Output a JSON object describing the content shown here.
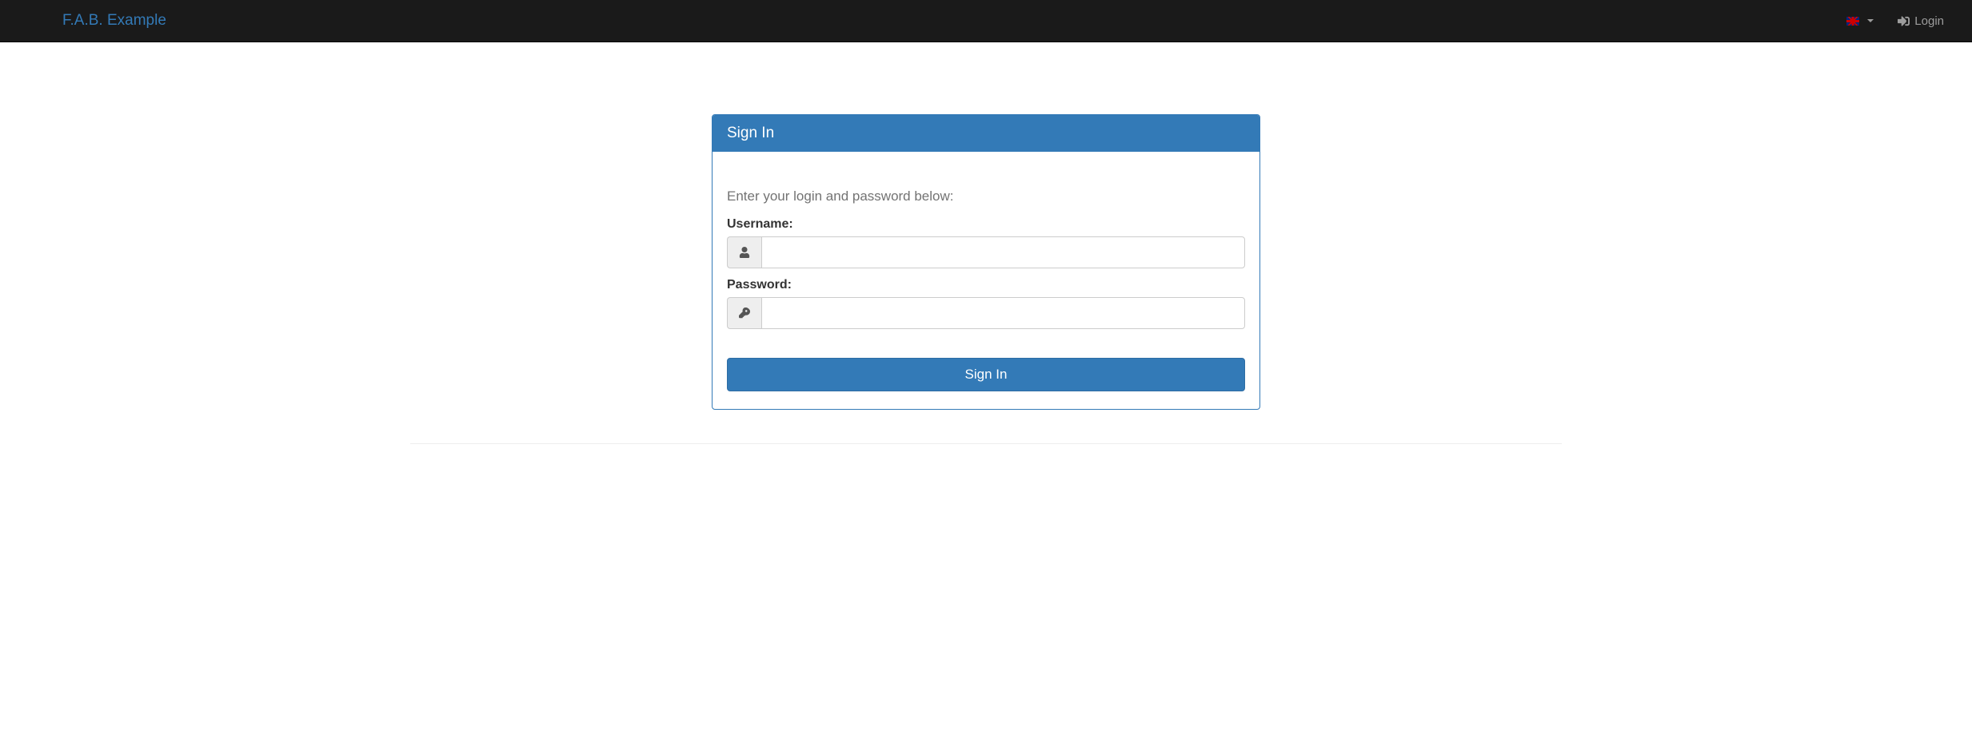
{
  "navbar": {
    "brand": "F.A.B. Example",
    "login_link": "Login"
  },
  "panel": {
    "title": "Sign In",
    "help_text": "Enter your login and password below:"
  },
  "form": {
    "username_label": "Username:",
    "password_label": "Password:",
    "submit_label": "Sign In"
  }
}
